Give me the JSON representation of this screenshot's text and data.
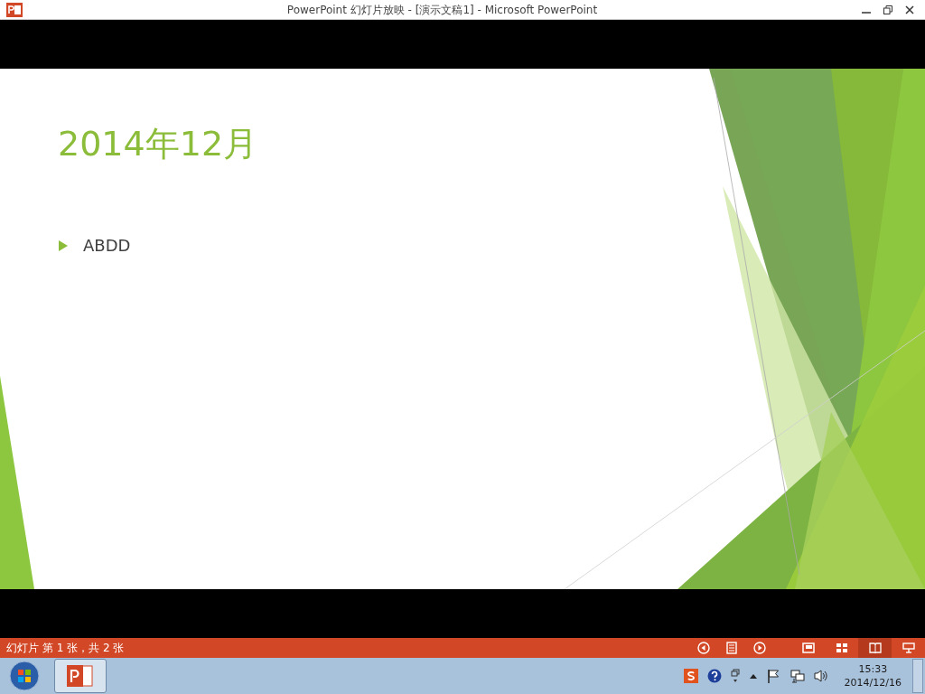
{
  "window": {
    "title": "PowerPoint 幻灯片放映 - [演示文稿1] - Microsoft PowerPoint"
  },
  "slide": {
    "title": "2014年12月",
    "bullets": [
      "ABDD"
    ]
  },
  "status_bar": {
    "text": "幻灯片 第 1 张，共 2 张",
    "views": [
      {
        "kind": "normal",
        "selected": false
      },
      {
        "kind": "sorter",
        "selected": false
      },
      {
        "kind": "reading",
        "selected": true
      },
      {
        "kind": "show",
        "selected": false
      }
    ]
  },
  "taskbar": {
    "apps": [
      {
        "kind": "powerpoint",
        "selected": true
      }
    ],
    "clock": {
      "time": "15:33",
      "date": "2014/12/16"
    }
  }
}
